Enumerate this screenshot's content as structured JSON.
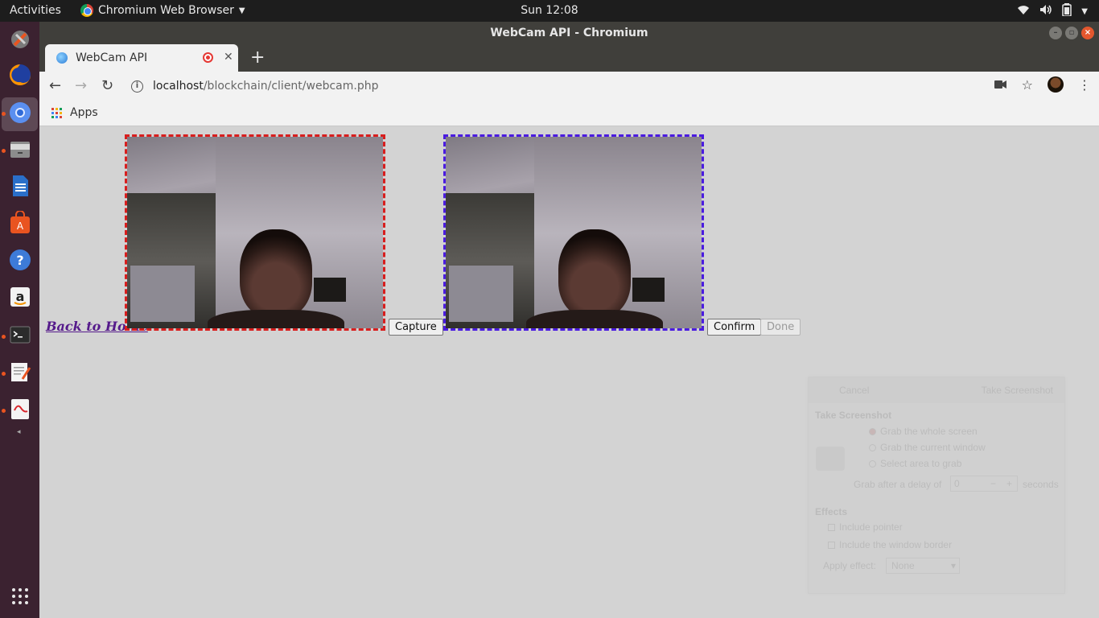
{
  "topbar": {
    "activities": "Activities",
    "app_menu": "Chromium Web Browser",
    "clock": "Sun 12:08"
  },
  "dock": {
    "items": [
      {
        "name": "system-settings"
      },
      {
        "name": "firefox"
      },
      {
        "name": "chromium"
      },
      {
        "name": "files"
      },
      {
        "name": "libreoffice-writer"
      },
      {
        "name": "ubuntu-software"
      },
      {
        "name": "help"
      },
      {
        "name": "amazon"
      },
      {
        "name": "terminal"
      },
      {
        "name": "text-editor"
      },
      {
        "name": "document-viewer"
      }
    ]
  },
  "window": {
    "title": "WebCam API - Chromium"
  },
  "tabs": [
    {
      "label": "WebCam API"
    }
  ],
  "address": {
    "host": "localhost",
    "path": "/blockchain/client/webcam.php"
  },
  "bookmarks": {
    "apps_label": "Apps"
  },
  "page": {
    "back_link": "Back to Home",
    "capture_button": "Capture",
    "confirm_button": "Confirm",
    "done_button": "Done"
  },
  "screenshot_dialog": {
    "cancel": "Cancel",
    "take": "Take Screenshot",
    "section_title": "Take Screenshot",
    "options": [
      "Grab the whole screen",
      "Grab the current window",
      "Select area to grab"
    ],
    "delay_label": "Grab after a delay of",
    "delay_value": "0",
    "seconds": "seconds",
    "effects_title": "Effects",
    "effects": [
      "Include pointer",
      "Include the window border"
    ],
    "apply_effect_label": "Apply effect:",
    "apply_effect_value": "None"
  },
  "colors": {
    "live_border": "#d81e1e",
    "snapshot_border": "#4a1be0",
    "ubuntu_orange": "#e95420"
  }
}
